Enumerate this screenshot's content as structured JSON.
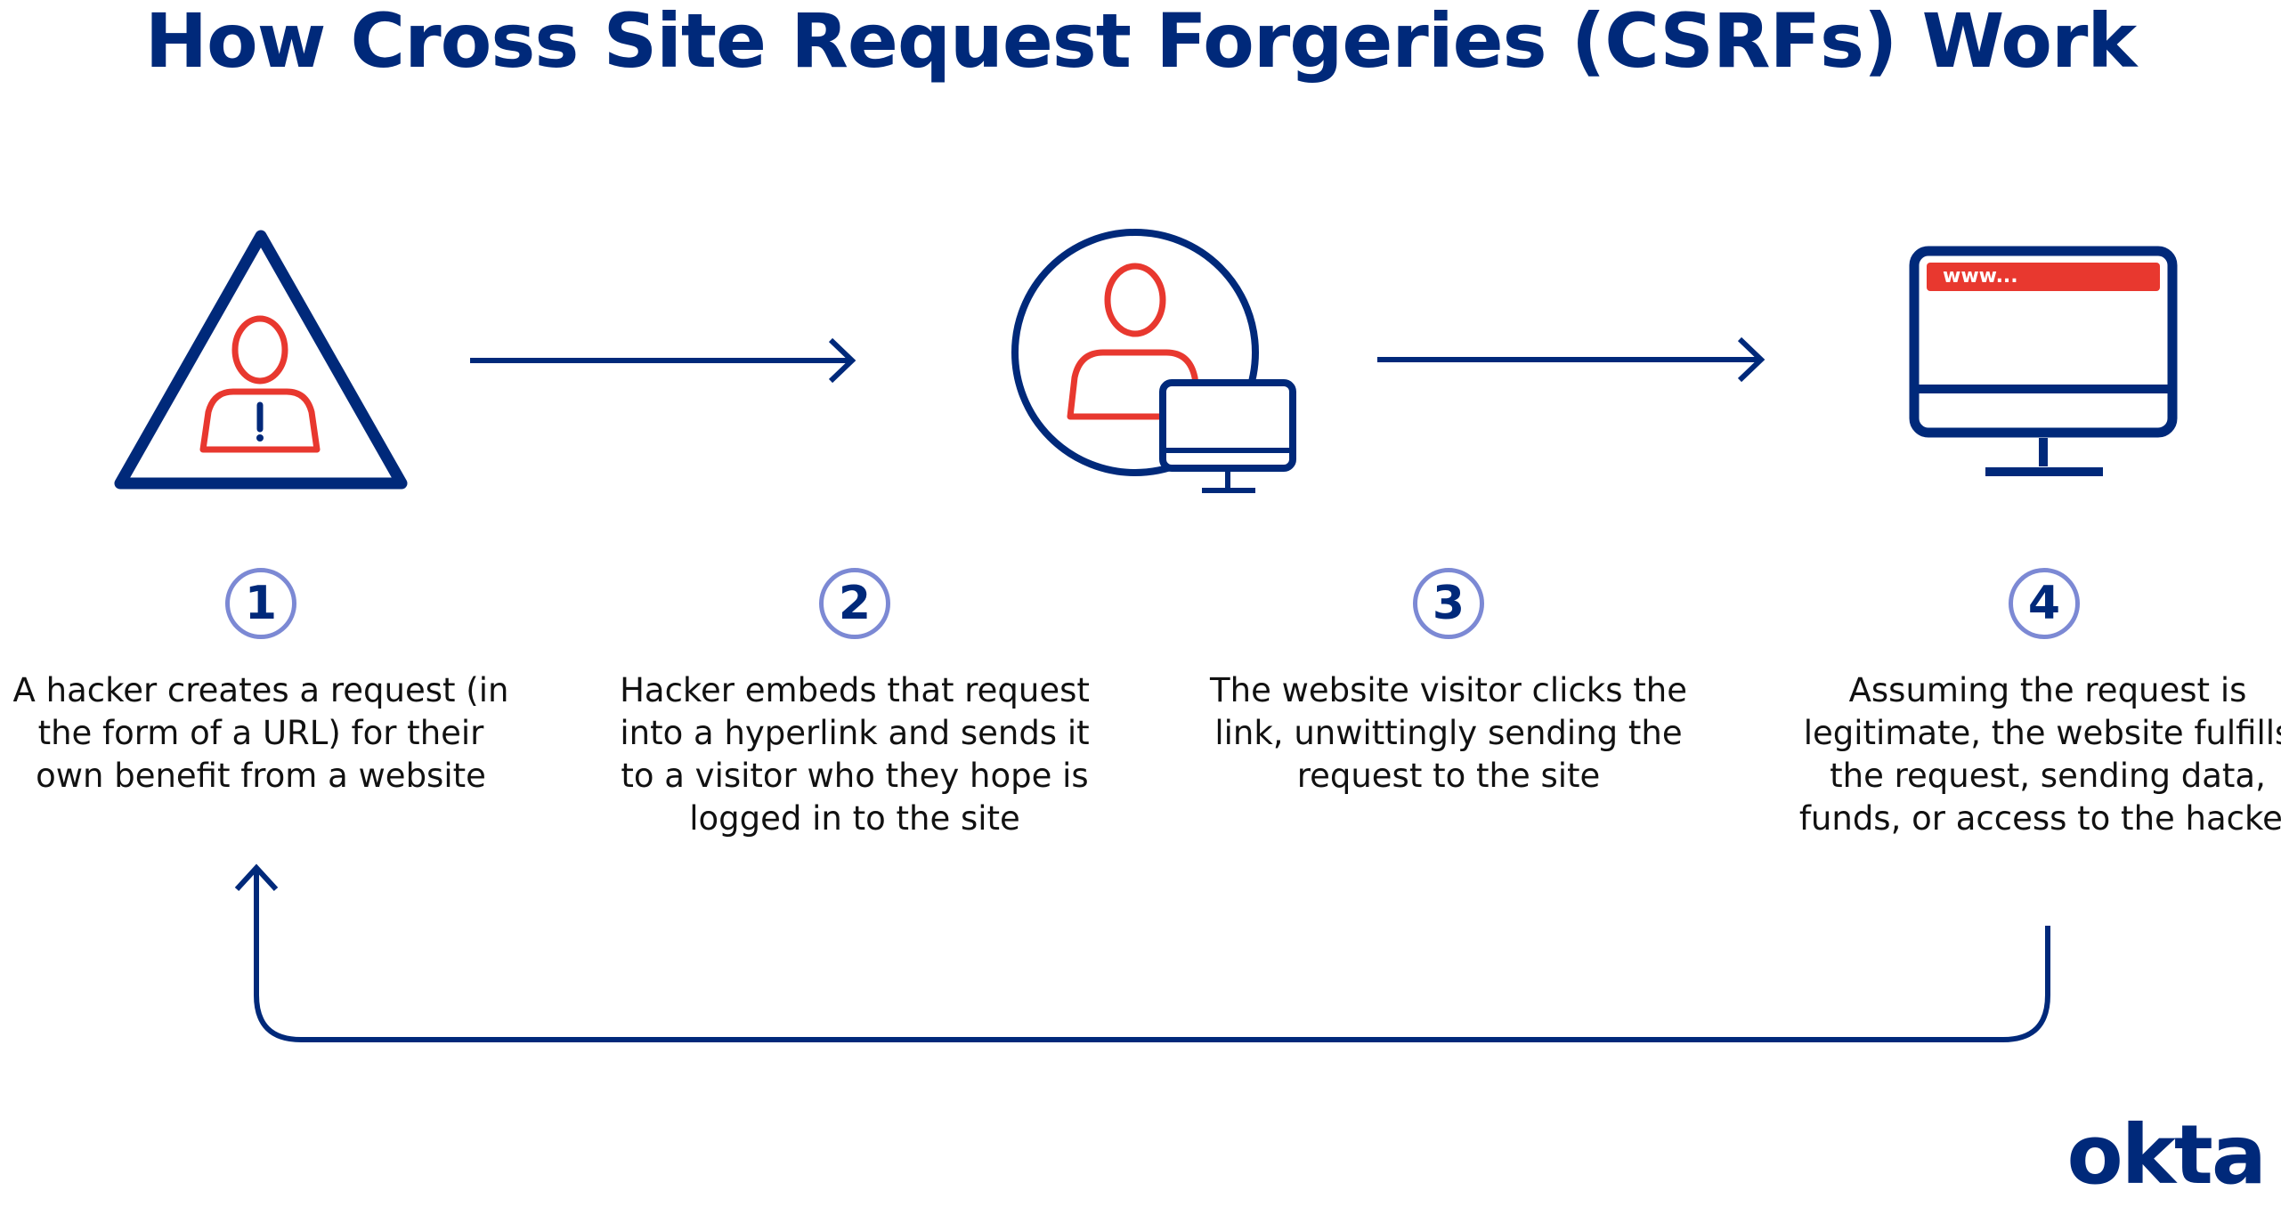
{
  "title": "How Cross Site Request Forgeries (CSRFs) Work",
  "colors": {
    "navy": "#00297A",
    "red": "#E8382F",
    "circle": "#7C89D4"
  },
  "steps": [
    {
      "number": "1",
      "icon": "warning-triangle-hacker-icon",
      "text": "A hacker creates a request (in the form of a URL) for their own benefit from a website"
    },
    {
      "number": "2",
      "icon": "user-with-computer-icon",
      "text": "Hacker embeds that request into a hyperlink and sends it to a visitor who they hope is logged in to the site"
    },
    {
      "number": "3",
      "icon": "",
      "text": "The website visitor clicks the link, unwittingly sending the request to the site"
    },
    {
      "number": "4",
      "icon": "website-monitor-icon",
      "text": "Assuming the request is legitimate, the website fulfills the request, sending data, funds, or access to the hacker"
    }
  ],
  "browser_url_text": "www...",
  "logo": "okta"
}
